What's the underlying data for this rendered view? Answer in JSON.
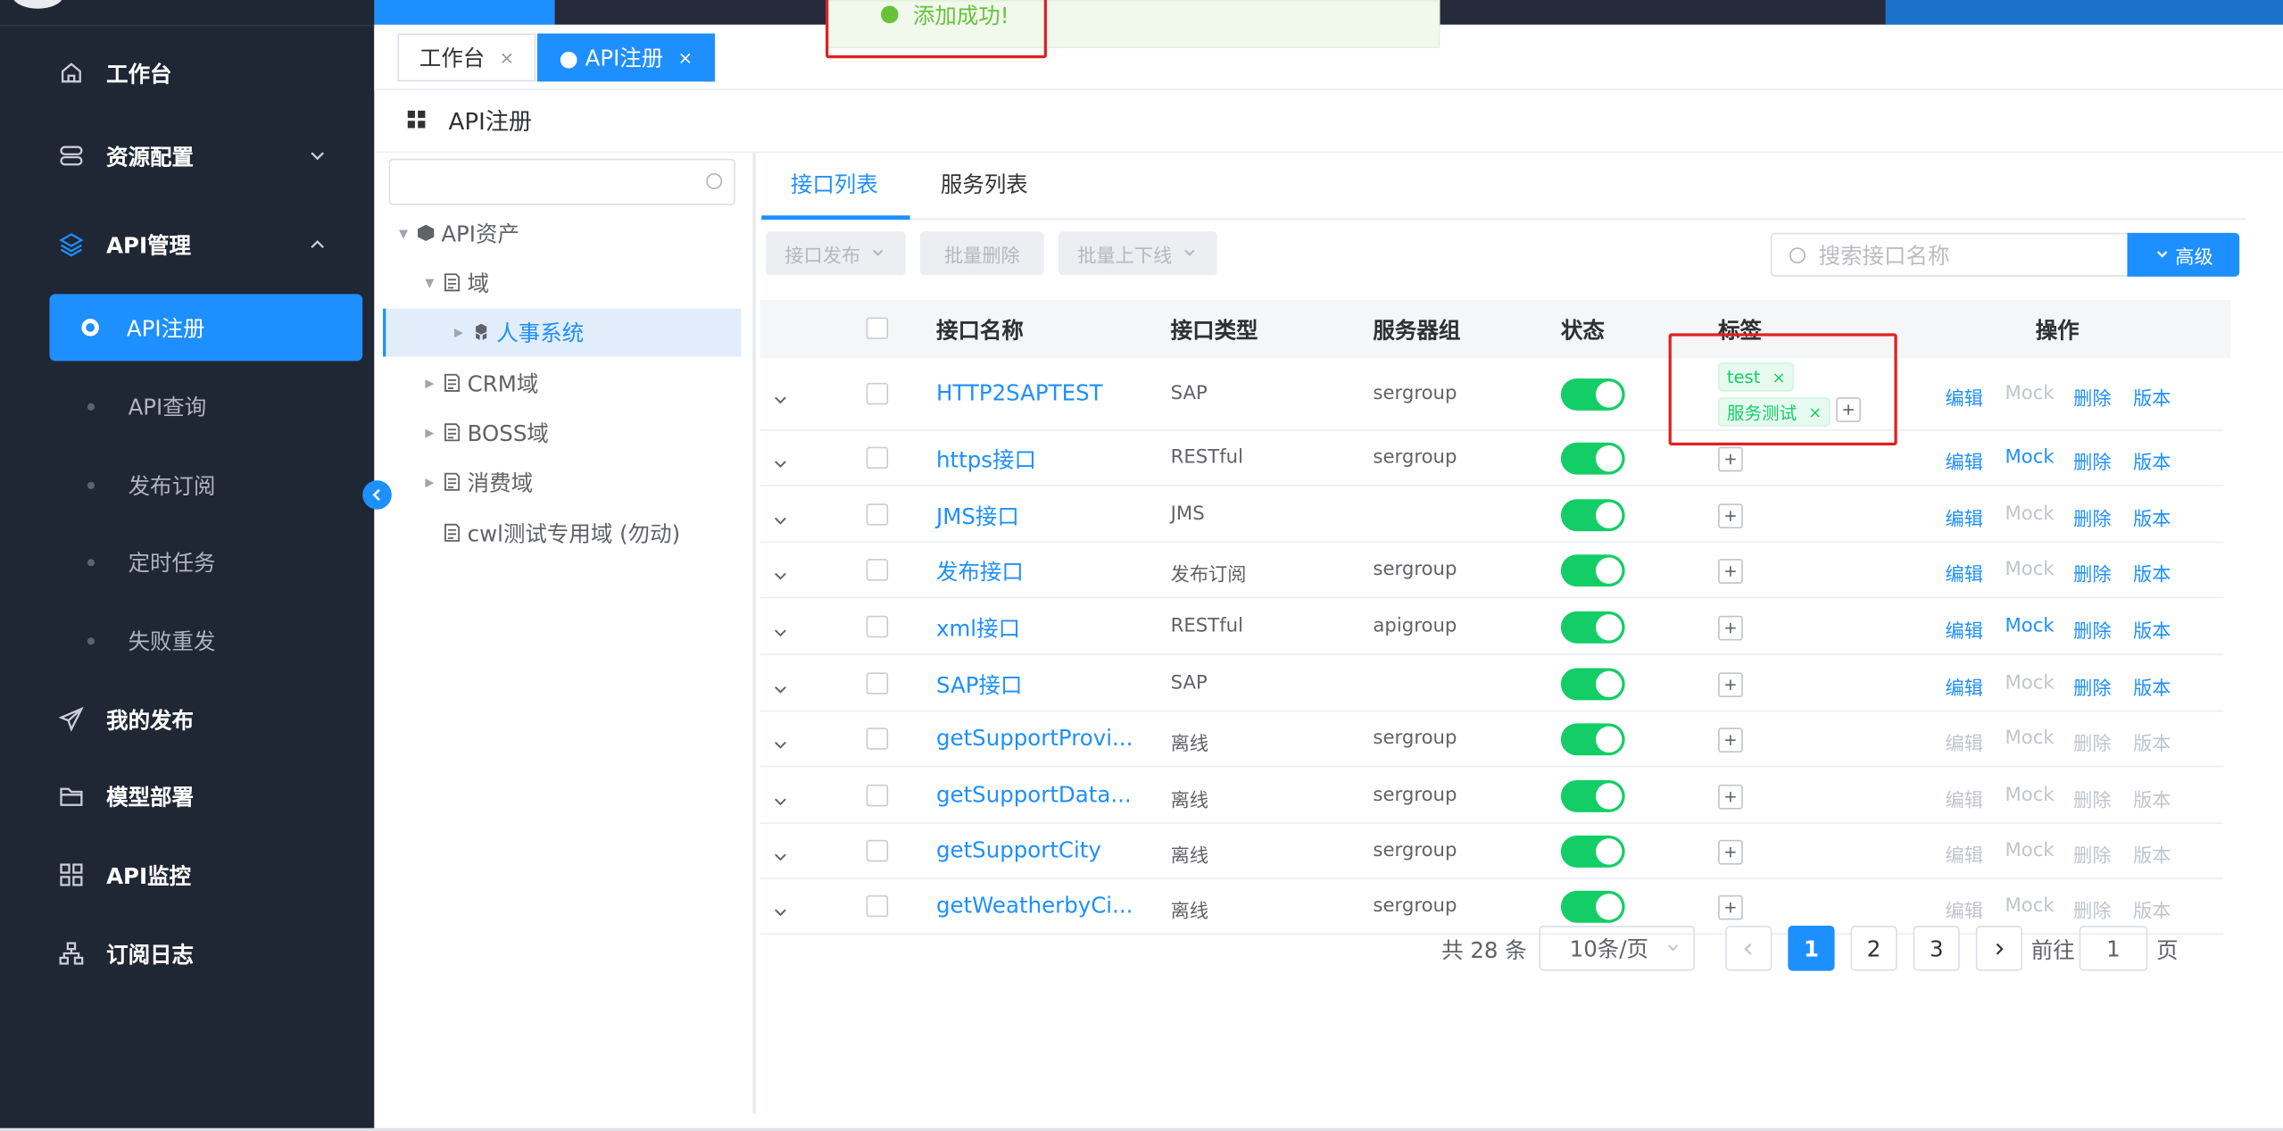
{
  "toast": {
    "message": "添加成功!"
  },
  "sidebar": {
    "items": [
      {
        "label": "工作台",
        "icon": "home-icon"
      },
      {
        "label": "资源配置",
        "icon": "server-icon"
      },
      {
        "label": "API管理",
        "icon": "layers-icon"
      },
      {
        "label": "我的发布",
        "icon": "send-icon"
      },
      {
        "label": "模型部署",
        "icon": "folder-icon"
      },
      {
        "label": "API监控",
        "icon": "grid-icon"
      },
      {
        "label": "订阅日志",
        "icon": "sitemap-icon"
      }
    ],
    "sub_items": [
      {
        "label": "API注册",
        "active": true
      },
      {
        "label": "API查询"
      },
      {
        "label": "发布订阅"
      },
      {
        "label": "定时任务"
      },
      {
        "label": "失败重发"
      }
    ]
  },
  "tabs": [
    {
      "label": "工作台",
      "close": "×"
    },
    {
      "label": "● API注册",
      "close": "×"
    }
  ],
  "page_title": "API注册",
  "tree": {
    "search_placeholder": "",
    "nodes": [
      {
        "label": "API资产"
      },
      {
        "label": "域"
      },
      {
        "label": "人事系统",
        "selected": true
      },
      {
        "label": "CRM域"
      },
      {
        "label": "BOSS域"
      },
      {
        "label": "消费域"
      },
      {
        "label": "cwl测试专用域 (勿动)"
      }
    ]
  },
  "content_tabs": [
    {
      "label": "接口列表",
      "active": true
    },
    {
      "label": "服务列表"
    }
  ],
  "toolbar": {
    "publish": "接口发布",
    "batch_delete": "批量删除",
    "batch_online": "批量上下线",
    "search_placeholder": "搜索接口名称",
    "advanced": "高级"
  },
  "table": {
    "headers": [
      "接口名称",
      "接口类型",
      "服务器组",
      "状态",
      "标签",
      "操作"
    ],
    "rows": [
      {
        "name": "HTTP2SAPTEST",
        "type": "SAP",
        "group": "sergroup",
        "status": "on",
        "tags": [
          "test",
          "服务测试"
        ],
        "ops": [
          "编辑",
          "Mock",
          "删除",
          "版本"
        ]
      },
      {
        "name": "https接口",
        "type": "RESTful",
        "group": "sergroup",
        "status": "on",
        "tags": [],
        "ops": [
          "编辑",
          "Mock",
          "删除",
          "版本"
        ]
      },
      {
        "name": "JMS接口",
        "type": "JMS",
        "group": "",
        "status": "on",
        "tags": [],
        "ops": [
          "编辑",
          "Mock",
          "删除",
          "版本"
        ]
      },
      {
        "name": "发布接口",
        "type": "发布订阅",
        "group": "sergroup",
        "status": "on",
        "tags": [],
        "ops": [
          "编辑",
          "Mock",
          "删除",
          "版本"
        ]
      },
      {
        "name": "xml接口",
        "type": "RESTful",
        "group": "apigroup",
        "status": "on",
        "tags": [],
        "ops": [
          "编辑",
          "Mock",
          "删除",
          "版本"
        ]
      },
      {
        "name": "SAP接口",
        "type": "SAP",
        "group": "",
        "status": "on",
        "tags": [],
        "ops": [
          "编辑",
          "Mock",
          "删除",
          "版本"
        ]
      },
      {
        "name": "getSupportProvi...",
        "type": "离线",
        "group": "sergroup",
        "status": "on",
        "tags": [],
        "ops": [
          "编辑",
          "Mock",
          "删除",
          "版本"
        ]
      },
      {
        "name": "getSupportData...",
        "type": "离线",
        "group": "sergroup",
        "status": "on",
        "tags": [],
        "ops": [
          "编辑",
          "Mock",
          "删除",
          "版本"
        ]
      },
      {
        "name": "getSupportCity",
        "type": "离线",
        "group": "sergroup",
        "status": "on",
        "tags": [],
        "ops": [
          "编辑",
          "Mock",
          "删除",
          "版本"
        ]
      },
      {
        "name": "getWeatherbyCi...",
        "type": "离线",
        "group": "sergroup",
        "status": "on",
        "tags": [],
        "ops": [
          "编辑",
          "Mock",
          "删除",
          "版本"
        ]
      }
    ]
  },
  "pagination": {
    "total": "共 28 条",
    "page_size": "10条/页",
    "pages": [
      "1",
      "2",
      "3"
    ],
    "current": "1",
    "goto_label": "前往",
    "goto_value": "1",
    "page_label": "页"
  },
  "colors": {
    "accent": "#1e8fff",
    "sidebar": "#1f2634",
    "switch_on": "#13ce66",
    "toast_success": "#67c23a",
    "highlight_box": "#e02020"
  }
}
